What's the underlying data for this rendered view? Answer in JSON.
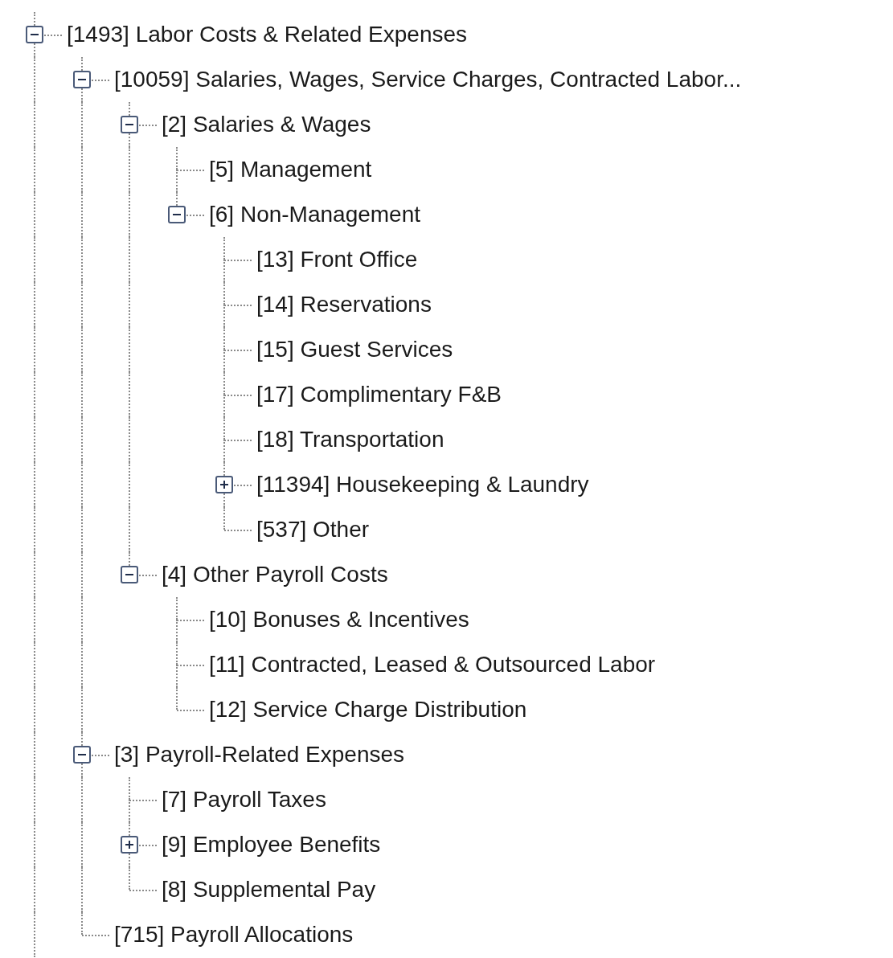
{
  "tree": [
    {
      "label": "[1493] Labor Costs & Related Expenses",
      "expanded": true,
      "children": [
        {
          "label": "[10059] Salaries, Wages, Service Charges, Contracted Labor...",
          "expanded": true,
          "children": [
            {
              "label": "[2] Salaries & Wages",
              "expanded": true,
              "children": [
                {
                  "label": "[5] Management"
                },
                {
                  "label": "[6] Non-Management",
                  "expanded": true,
                  "children": [
                    {
                      "label": "[13] Front Office"
                    },
                    {
                      "label": "[14] Reservations"
                    },
                    {
                      "label": "[15] Guest Services"
                    },
                    {
                      "label": "[17] Complimentary F&B"
                    },
                    {
                      "label": "[18] Transportation"
                    },
                    {
                      "label": "[11394] Housekeeping & Laundry",
                      "expanded": false
                    },
                    {
                      "label": "[537] Other"
                    }
                  ]
                }
              ]
            },
            {
              "label": "[4] Other Payroll Costs",
              "expanded": true,
              "children": [
                {
                  "label": "[10] Bonuses & Incentives"
                },
                {
                  "label": "[11] Contracted, Leased & Outsourced Labor"
                },
                {
                  "label": "[12] Service Charge Distribution"
                }
              ]
            }
          ]
        },
        {
          "label": "[3] Payroll-Related Expenses",
          "expanded": true,
          "children": [
            {
              "label": "[7] Payroll Taxes"
            },
            {
              "label": "[9] Employee Benefits",
              "expanded": false
            },
            {
              "label": "[8] Supplemental Pay"
            }
          ]
        },
        {
          "label": "[715] Payroll Allocations"
        }
      ]
    }
  ]
}
